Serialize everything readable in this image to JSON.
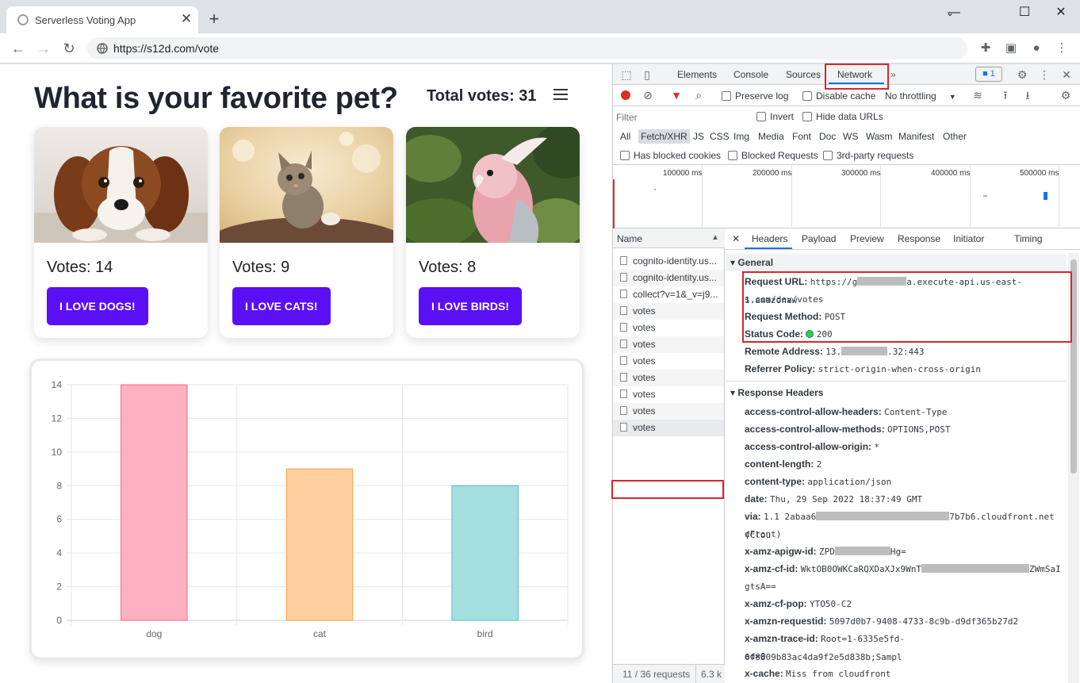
{
  "browser": {
    "tab_title": "Serverless Voting App",
    "new_tab_label": "+",
    "tab_close": "✕",
    "url": "https://s12d.com/vote"
  },
  "page": {
    "title": "What is your favorite pet?",
    "total_votes": "Total votes: 31",
    "cards": [
      {
        "votes": "Votes: 14",
        "button": "I LOVE DOGS!"
      },
      {
        "votes": "Votes: 9",
        "button": "I LOVE CATS!"
      },
      {
        "votes": "Votes: 8",
        "button": "I LOVE BIRDS!"
      }
    ],
    "accent": "#5b0ff5"
  },
  "chart_data": {
    "type": "bar",
    "categories": [
      "dog",
      "cat",
      "bird"
    ],
    "values": [
      14,
      9,
      8
    ],
    "ylim": [
      0,
      14
    ],
    "yticks": [
      0,
      2,
      4,
      6,
      8,
      10,
      12,
      14
    ],
    "colors": [
      "#ffb1c1",
      "#ffcf9f",
      "#a5dfdf"
    ],
    "border_colors": [
      "#ff6384",
      "#ff9f40",
      "#4bc0c0"
    ],
    "grid": true,
    "legend": "none"
  },
  "devtools": {
    "tabs": [
      "Elements",
      "Console",
      "Sources",
      "Network"
    ],
    "more": "»",
    "issues_count": "1",
    "preserve_log": "Preserve log",
    "disable_cache": "Disable cache",
    "throttling": "No throttling",
    "filter_placeholder": "Filter",
    "invert": "Invert",
    "hide_data_urls": "Hide data URLs",
    "types": [
      "All",
      "Fetch/XHR",
      "JS",
      "CSS",
      "Img",
      "Media",
      "Font",
      "Doc",
      "WS",
      "Wasm",
      "Manifest",
      "Other"
    ],
    "has_blocked_cookies": "Has blocked cookies",
    "blocked_requests": "Blocked Requests",
    "third_party": "3rd-party requests",
    "overview_labels": [
      "100000 ms",
      "200000 ms",
      "300000 ms",
      "400000 ms",
      "500000 ms"
    ],
    "list_header": "Name",
    "requests": [
      "cognito-identity.us...",
      "cognito-identity.us...",
      "collect?v=1&_v=j9...",
      "votes",
      "votes",
      "votes",
      "votes",
      "votes",
      "votes",
      "votes",
      "votes"
    ],
    "footer": "11 / 36 requests",
    "footer_size": "6.3 k",
    "detail_tabs": [
      "Headers",
      "Payload",
      "Preview",
      "Response",
      "Initiator",
      "Timing"
    ],
    "general_title": "General",
    "request_url_label": "Request URL:",
    "request_url_a": "https://g",
    "request_url_b": "a.execute-api.us-east-1.amazonaw",
    "request_url_c": "s.com/dev/votes",
    "request_method_label": "Request Method:",
    "request_method": "POST",
    "status_code_label": "Status Code:",
    "status_code": "200",
    "remote_address_label": "Remote Address:",
    "remote_address_a": "13.",
    "remote_address_b": ".32:443",
    "referrer_label": "Referrer Policy:",
    "referrer": "strict-origin-when-cross-origin",
    "response_title": "Response Headers",
    "response_headers": [
      {
        "name": "access-control-allow-headers:",
        "value": "Content-Type"
      },
      {
        "name": "access-control-allow-methods:",
        "value": "OPTIONS,POST"
      },
      {
        "name": "access-control-allow-origin:",
        "value": "*"
      },
      {
        "name": "content-length:",
        "value": "2"
      },
      {
        "name": "content-type:",
        "value": "application/json"
      },
      {
        "name": "date:",
        "value": "Thu, 29 Sep 2022 18:37:49 GMT"
      }
    ],
    "via_label": "via:",
    "via_a": "1.1 2abaa6",
    "via_b": "7b7b6.cloudfront.net (Clou",
    "via_c": "dFront)",
    "apigw_label": "x-amz-apigw-id:",
    "apigw_a": "ZPD",
    "apigw_b": "Hg=",
    "cfid_label": "x-amz-cf-id:",
    "cfid_a": "WktOB0OWKCaRQXDaXJx9WnT",
    "cfid_b": "ZWmSaI",
    "cfid_c": "gtsA==",
    "cfpop_label": "x-amz-cf-pop:",
    "cfpop": "YTO50-C2",
    "reqid_label": "x-amzn-requestid:",
    "reqid": "5097d0b7-9408-4733-8c9b-d9df365b27d2",
    "trace_label": "x-amzn-trace-id:",
    "trace_a": "Root=1-6335e5fd-6f8809b83ac4da9f2e5d838b;Sampl",
    "trace_b": "ed=0",
    "xcache_label": "x-cache:",
    "xcache": "Miss from cloudfront"
  }
}
